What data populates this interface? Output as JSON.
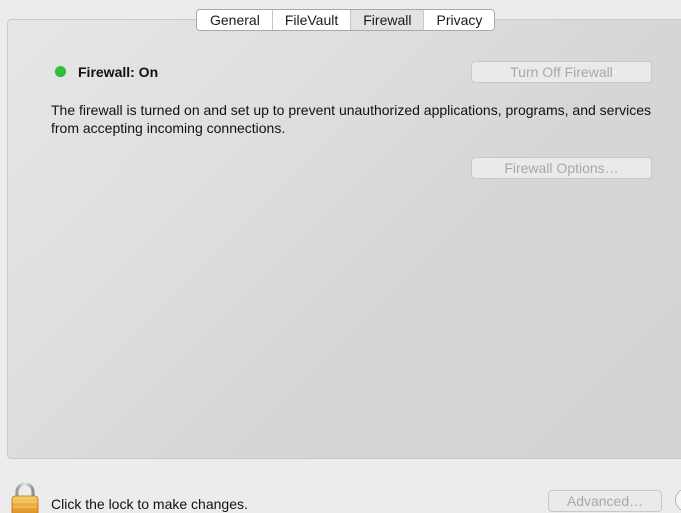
{
  "tabs": [
    {
      "label": "General",
      "selected": false
    },
    {
      "label": "FileVault",
      "selected": false
    },
    {
      "label": "Firewall",
      "selected": true
    },
    {
      "label": "Privacy",
      "selected": false
    }
  ],
  "firewall": {
    "status_text": "Firewall: On",
    "status_color": "#2ec13b",
    "description": "The firewall is turned on and set up to prevent unauthorized applications, programs, and services from accepting incoming connections.",
    "turn_off_label": "Turn Off Firewall",
    "options_label": "Firewall Options…"
  },
  "footer": {
    "lock_label": "Click the lock to make changes.",
    "advanced_label": "Advanced…"
  },
  "icons": {
    "lock": "lock-icon",
    "status": "status-dot-icon",
    "help": "help-icon"
  }
}
